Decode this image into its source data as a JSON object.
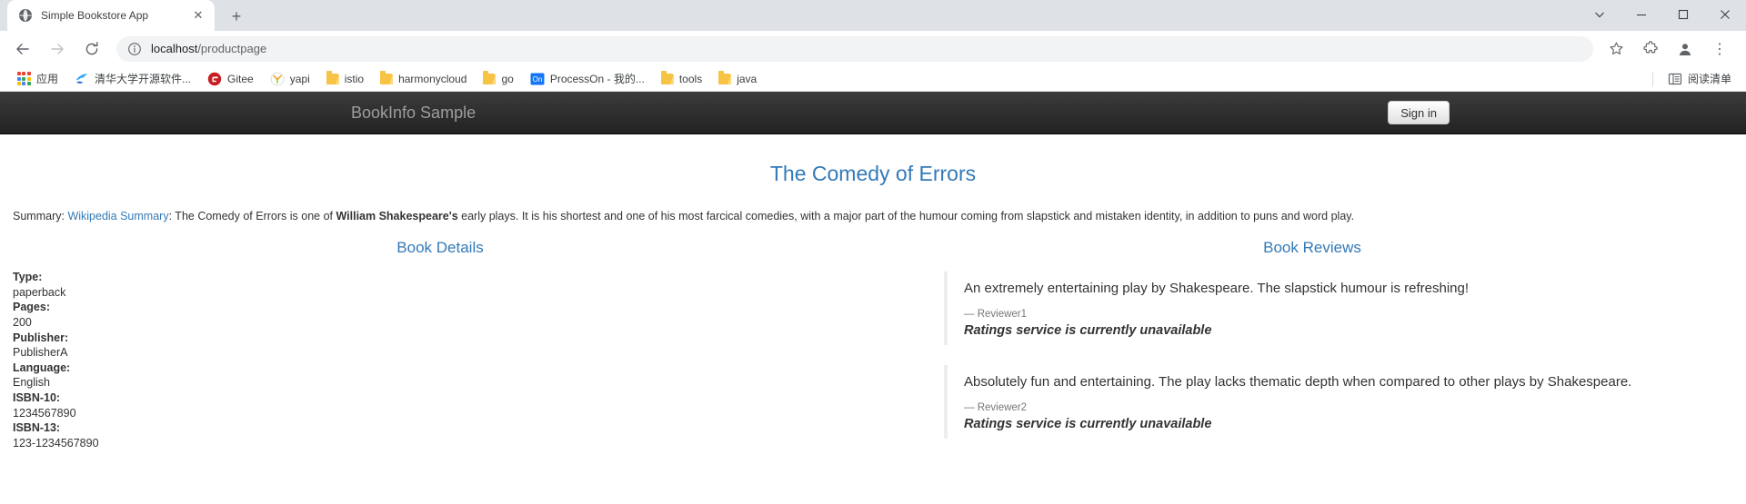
{
  "browser": {
    "tab": {
      "title": "Simple Bookstore App",
      "favicon_name": "globe-favicon",
      "close_label": "✕"
    },
    "new_tab_label": "+",
    "window_controls": {
      "chevron_label": "chevron-down",
      "minimize_label": "minimize",
      "maximize_label": "maximize",
      "close_label": "close"
    },
    "toolbar": {
      "back_label": "←",
      "forward_label": "→",
      "reload_label": "↻",
      "url_host": "localhost",
      "url_path": "/productpage",
      "url_full": "localhost/productpage",
      "star_label": "☆",
      "extensions_label": "extensions",
      "profile_label": "profile",
      "menu_label": "⋮"
    },
    "bookmarks": [
      {
        "label": "应用",
        "icon": "apps-grid-icon"
      },
      {
        "label": "清华大学开源软件...",
        "icon": "tuna-mirror-icon"
      },
      {
        "label": "Gitee",
        "icon": "gitee-icon"
      },
      {
        "label": "yapi",
        "icon": "yapi-icon"
      },
      {
        "label": "istio",
        "icon": "folder-icon"
      },
      {
        "label": "harmonycloud",
        "icon": "folder-icon"
      },
      {
        "label": "go",
        "icon": "folder-icon"
      },
      {
        "label": "ProcessOn - 我的...",
        "icon": "processon-icon"
      },
      {
        "label": "tools",
        "icon": "folder-icon"
      },
      {
        "label": "java",
        "icon": "folder-icon"
      }
    ],
    "reading_list": {
      "label": "阅读清单",
      "icon": "reading-list-icon"
    }
  },
  "page": {
    "navbar": {
      "brand": "BookInfo Sample",
      "signin_label": "Sign in"
    },
    "book_title": "The Comedy of Errors",
    "summary": {
      "label": "Summary:",
      "link_text": "Wikipedia Summary",
      "separator": ":",
      "text_before_bold": " The Comedy of Errors is one of ",
      "bold_text": "William Shakespeare's",
      "text_after_bold": " early plays. It is his shortest and one of his most farcical comedies, with a major part of the humour coming from slapstick and mistaken identity, in addition to puns and word play."
    },
    "details": {
      "title": "Book Details",
      "items": [
        {
          "label": "Type:",
          "value": "paperback"
        },
        {
          "label": "Pages:",
          "value": "200"
        },
        {
          "label": "Publisher:",
          "value": "PublisherA"
        },
        {
          "label": "Language:",
          "value": "English"
        },
        {
          "label": "ISBN-10:",
          "value": "1234567890"
        },
        {
          "label": "ISBN-13:",
          "value": "123-1234567890"
        }
      ]
    },
    "reviews": {
      "title": "Book Reviews",
      "items": [
        {
          "text": "An extremely entertaining play by Shakespeare. The slapstick humour is refreshing!",
          "author": "— Reviewer1",
          "rating": "Ratings service is currently unavailable"
        },
        {
          "text": "Absolutely fun and entertaining. The play lacks thematic depth when compared to other plays by Shakespeare.",
          "author": "— Reviewer2",
          "rating": "Ratings service is currently unavailable"
        }
      ]
    }
  },
  "colors": {
    "link_blue": "#337ab7",
    "navbar_dark": "#222222",
    "chrome_gray": "#dee1e6"
  }
}
